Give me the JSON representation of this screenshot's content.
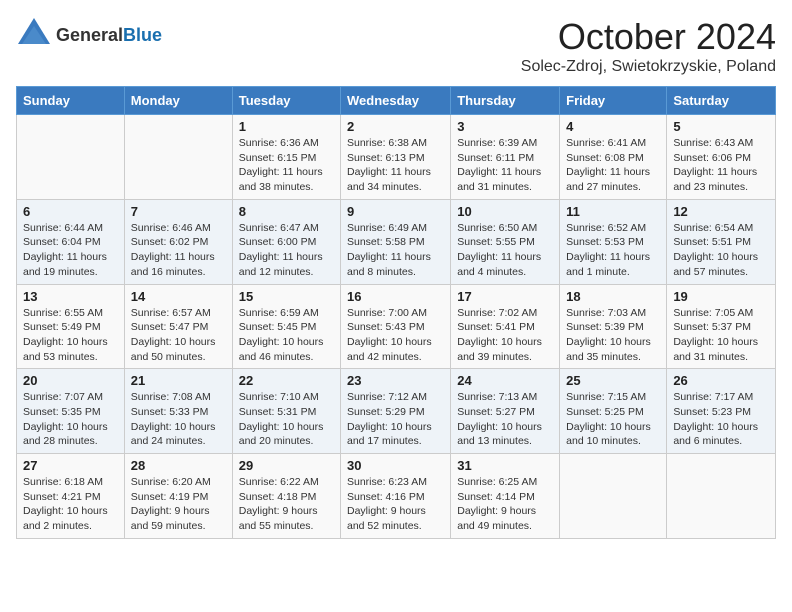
{
  "header": {
    "logo_line1": "General",
    "logo_line2": "Blue",
    "month": "October 2024",
    "location": "Solec-Zdroj, Swietokrzyskie, Poland"
  },
  "weekdays": [
    "Sunday",
    "Monday",
    "Tuesday",
    "Wednesday",
    "Thursday",
    "Friday",
    "Saturday"
  ],
  "weeks": [
    [
      {
        "day": "",
        "info": ""
      },
      {
        "day": "",
        "info": ""
      },
      {
        "day": "1",
        "info": "Sunrise: 6:36 AM\nSunset: 6:15 PM\nDaylight: 11 hours and 38 minutes."
      },
      {
        "day": "2",
        "info": "Sunrise: 6:38 AM\nSunset: 6:13 PM\nDaylight: 11 hours and 34 minutes."
      },
      {
        "day": "3",
        "info": "Sunrise: 6:39 AM\nSunset: 6:11 PM\nDaylight: 11 hours and 31 minutes."
      },
      {
        "day": "4",
        "info": "Sunrise: 6:41 AM\nSunset: 6:08 PM\nDaylight: 11 hours and 27 minutes."
      },
      {
        "day": "5",
        "info": "Sunrise: 6:43 AM\nSunset: 6:06 PM\nDaylight: 11 hours and 23 minutes."
      }
    ],
    [
      {
        "day": "6",
        "info": "Sunrise: 6:44 AM\nSunset: 6:04 PM\nDaylight: 11 hours and 19 minutes."
      },
      {
        "day": "7",
        "info": "Sunrise: 6:46 AM\nSunset: 6:02 PM\nDaylight: 11 hours and 16 minutes."
      },
      {
        "day": "8",
        "info": "Sunrise: 6:47 AM\nSunset: 6:00 PM\nDaylight: 11 hours and 12 minutes."
      },
      {
        "day": "9",
        "info": "Sunrise: 6:49 AM\nSunset: 5:58 PM\nDaylight: 11 hours and 8 minutes."
      },
      {
        "day": "10",
        "info": "Sunrise: 6:50 AM\nSunset: 5:55 PM\nDaylight: 11 hours and 4 minutes."
      },
      {
        "day": "11",
        "info": "Sunrise: 6:52 AM\nSunset: 5:53 PM\nDaylight: 11 hours and 1 minute."
      },
      {
        "day": "12",
        "info": "Sunrise: 6:54 AM\nSunset: 5:51 PM\nDaylight: 10 hours and 57 minutes."
      }
    ],
    [
      {
        "day": "13",
        "info": "Sunrise: 6:55 AM\nSunset: 5:49 PM\nDaylight: 10 hours and 53 minutes."
      },
      {
        "day": "14",
        "info": "Sunrise: 6:57 AM\nSunset: 5:47 PM\nDaylight: 10 hours and 50 minutes."
      },
      {
        "day": "15",
        "info": "Sunrise: 6:59 AM\nSunset: 5:45 PM\nDaylight: 10 hours and 46 minutes."
      },
      {
        "day": "16",
        "info": "Sunrise: 7:00 AM\nSunset: 5:43 PM\nDaylight: 10 hours and 42 minutes."
      },
      {
        "day": "17",
        "info": "Sunrise: 7:02 AM\nSunset: 5:41 PM\nDaylight: 10 hours and 39 minutes."
      },
      {
        "day": "18",
        "info": "Sunrise: 7:03 AM\nSunset: 5:39 PM\nDaylight: 10 hours and 35 minutes."
      },
      {
        "day": "19",
        "info": "Sunrise: 7:05 AM\nSunset: 5:37 PM\nDaylight: 10 hours and 31 minutes."
      }
    ],
    [
      {
        "day": "20",
        "info": "Sunrise: 7:07 AM\nSunset: 5:35 PM\nDaylight: 10 hours and 28 minutes."
      },
      {
        "day": "21",
        "info": "Sunrise: 7:08 AM\nSunset: 5:33 PM\nDaylight: 10 hours and 24 minutes."
      },
      {
        "day": "22",
        "info": "Sunrise: 7:10 AM\nSunset: 5:31 PM\nDaylight: 10 hours and 20 minutes."
      },
      {
        "day": "23",
        "info": "Sunrise: 7:12 AM\nSunset: 5:29 PM\nDaylight: 10 hours and 17 minutes."
      },
      {
        "day": "24",
        "info": "Sunrise: 7:13 AM\nSunset: 5:27 PM\nDaylight: 10 hours and 13 minutes."
      },
      {
        "day": "25",
        "info": "Sunrise: 7:15 AM\nSunset: 5:25 PM\nDaylight: 10 hours and 10 minutes."
      },
      {
        "day": "26",
        "info": "Sunrise: 7:17 AM\nSunset: 5:23 PM\nDaylight: 10 hours and 6 minutes."
      }
    ],
    [
      {
        "day": "27",
        "info": "Sunrise: 6:18 AM\nSunset: 4:21 PM\nDaylight: 10 hours and 2 minutes."
      },
      {
        "day": "28",
        "info": "Sunrise: 6:20 AM\nSunset: 4:19 PM\nDaylight: 9 hours and 59 minutes."
      },
      {
        "day": "29",
        "info": "Sunrise: 6:22 AM\nSunset: 4:18 PM\nDaylight: 9 hours and 55 minutes."
      },
      {
        "day": "30",
        "info": "Sunrise: 6:23 AM\nSunset: 4:16 PM\nDaylight: 9 hours and 52 minutes."
      },
      {
        "day": "31",
        "info": "Sunrise: 6:25 AM\nSunset: 4:14 PM\nDaylight: 9 hours and 49 minutes."
      },
      {
        "day": "",
        "info": ""
      },
      {
        "day": "",
        "info": ""
      }
    ]
  ]
}
